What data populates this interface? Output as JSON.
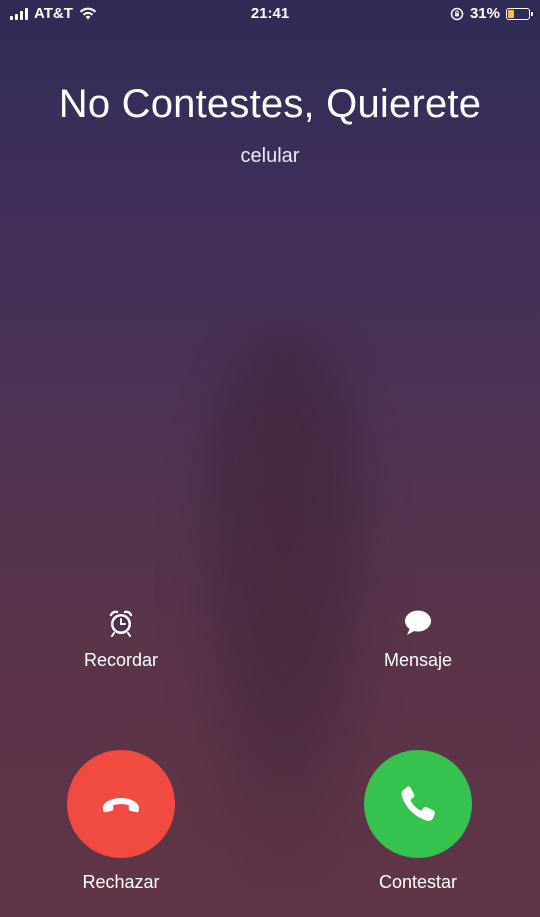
{
  "status_bar": {
    "carrier": "AT&T",
    "time": "21:41",
    "battery_percent": "31%",
    "battery_level": 0.31,
    "battery_color": "#f5c044"
  },
  "caller": {
    "name": "No Contestes, Quierete",
    "label": "celular"
  },
  "actions": {
    "remind_label": "Recordar",
    "message_label": "Mensaje",
    "decline_label": "Rechazar",
    "accept_label": "Contestar"
  },
  "colors": {
    "decline": "#f04a41",
    "accept": "#35c24f"
  },
  "icons": {
    "remind": "alarm-clock-icon",
    "message": "message-bubble-icon",
    "decline": "phone-hangup-icon",
    "accept": "phone-icon"
  }
}
